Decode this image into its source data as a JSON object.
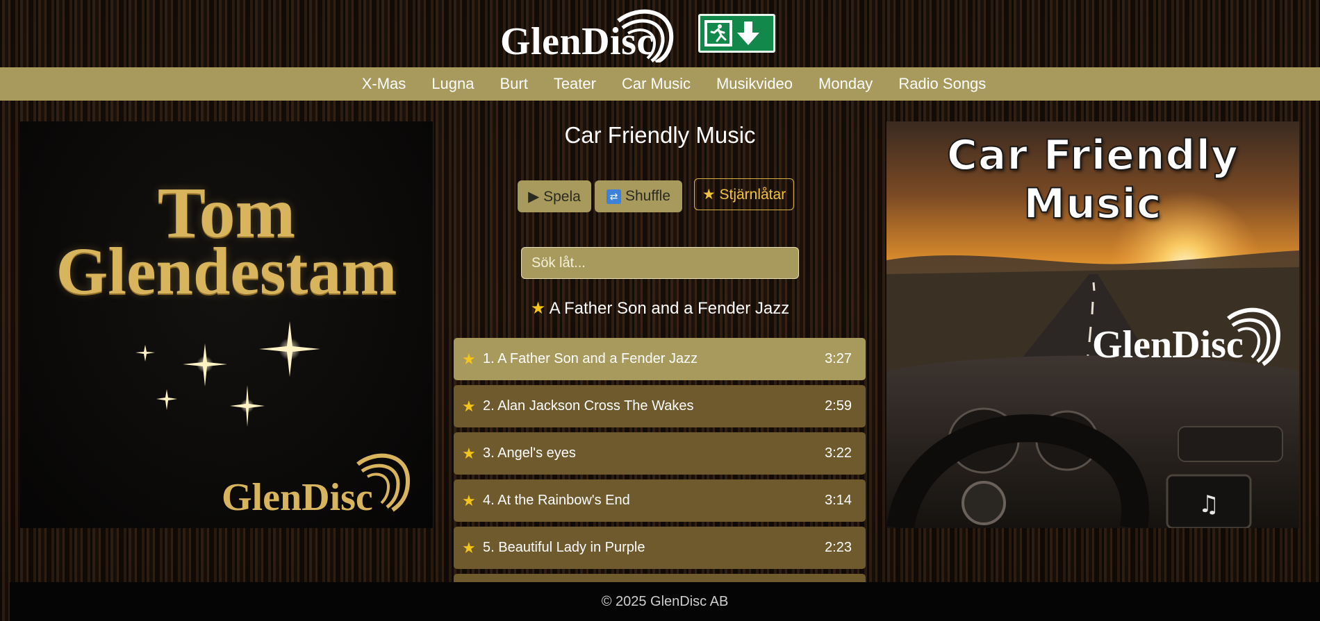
{
  "header": {
    "logo_text": "GlenDisc",
    "exit_icon": "emergency-exit-download-icon"
  },
  "nav": {
    "items": [
      {
        "label": "X-Mas"
      },
      {
        "label": "Lugna"
      },
      {
        "label": "Burt"
      },
      {
        "label": "Teater"
      },
      {
        "label": "Car Music"
      },
      {
        "label": "Musikvideo"
      },
      {
        "label": "Monday"
      },
      {
        "label": "Radio Songs"
      }
    ]
  },
  "left_cover": {
    "artist_line1": "Tom",
    "artist_line2": "Glendestam",
    "logo_text": "GlenDisc"
  },
  "right_cover": {
    "title": "Car Friendly Music",
    "logo_text": "GlenDisc"
  },
  "main": {
    "title": "Car Friendly Music",
    "play_label": "▶ Spela",
    "shuffle_label": "Shuffle",
    "starred_label": "★ Stjärnlåtar",
    "search_placeholder": "Sök låt...",
    "now_playing_star": "★",
    "now_playing": "A Father Son and a Fender Jazz"
  },
  "tracks": [
    {
      "name": "1. A Father Son and a Fender Jazz",
      "duration": "3:27",
      "active": true
    },
    {
      "name": "2. Alan Jackson Cross The Wakes",
      "duration": "2:59"
    },
    {
      "name": "3. Angel's eyes",
      "duration": "3:22"
    },
    {
      "name": "4. At the Rainbow's End",
      "duration": "3:14"
    },
    {
      "name": "5. Beautiful Lady in Purple",
      "duration": "2:23"
    }
  ],
  "footer": {
    "text": "© 2025 GlenDisc AB"
  },
  "colors": {
    "nav_bg": "#a89a5c",
    "track_bg": "#6f5a2e",
    "star": "#f5c518",
    "gold": "#d8b45c"
  }
}
